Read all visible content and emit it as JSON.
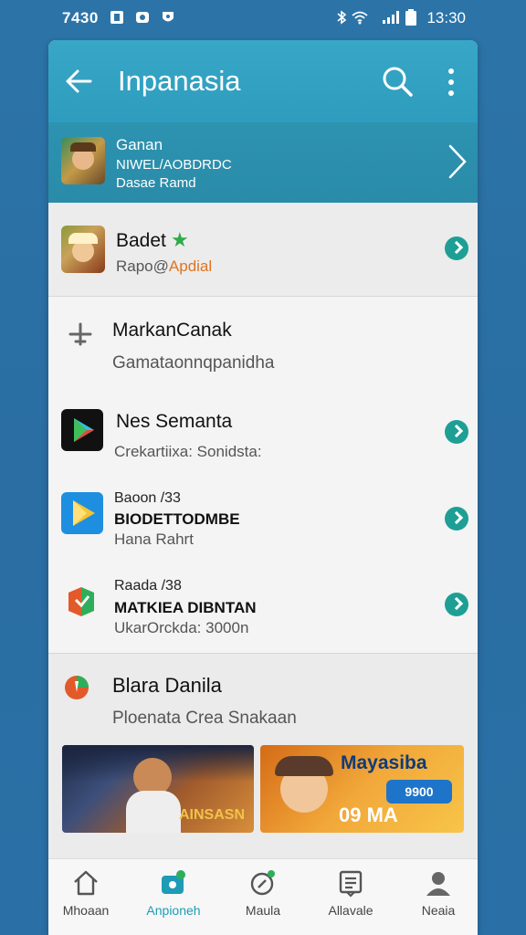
{
  "status_bar": {
    "time_left": "7430",
    "time_right": "13:30"
  },
  "app_bar": {
    "title": "Inpanasia"
  },
  "banner": {
    "line1": "Ganan",
    "line2": "NIWEL/AOBDRDC",
    "line3": "Dasae Ramd"
  },
  "list": [
    {
      "title": "Badet",
      "subtitle_pre": "Rapo@",
      "subtitle_accent": "Apdial"
    },
    {
      "title": "MarkanCanak",
      "subtitle": "Gamataonnqpanidha"
    },
    {
      "title": "Nes Semanta",
      "subtitle": "Crekartiixa: Sonidsta:"
    },
    {
      "small": "Baoon /33",
      "caps": "BIODETTODMBE",
      "subtitle": "Hana Rahrt"
    },
    {
      "small": "Raada /38",
      "caps": "MATKIEA DIBNTAN",
      "subtitle": "UkarOrckda: 3000n"
    }
  ],
  "section": {
    "title": "Blara Danila",
    "subtitle": "Ploenata Crea Snakaan",
    "promo1_text": "AINSASN",
    "promo2_title": "Mayasiba",
    "promo2_button": "9900",
    "promo2_amount": "09 MA"
  },
  "nav": [
    {
      "label": "Mhoaan",
      "icon": "home-icon"
    },
    {
      "label": "Anpioneh",
      "icon": "apps-icon"
    },
    {
      "label": "Maula",
      "icon": "games-icon"
    },
    {
      "label": "Allavale",
      "icon": "list-icon"
    },
    {
      "label": "Neaia",
      "icon": "profile-icon"
    }
  ],
  "colors": {
    "accent": "#2e9cbd",
    "go_button": "#1e9f95",
    "nav_active": "#1e9bb5"
  }
}
